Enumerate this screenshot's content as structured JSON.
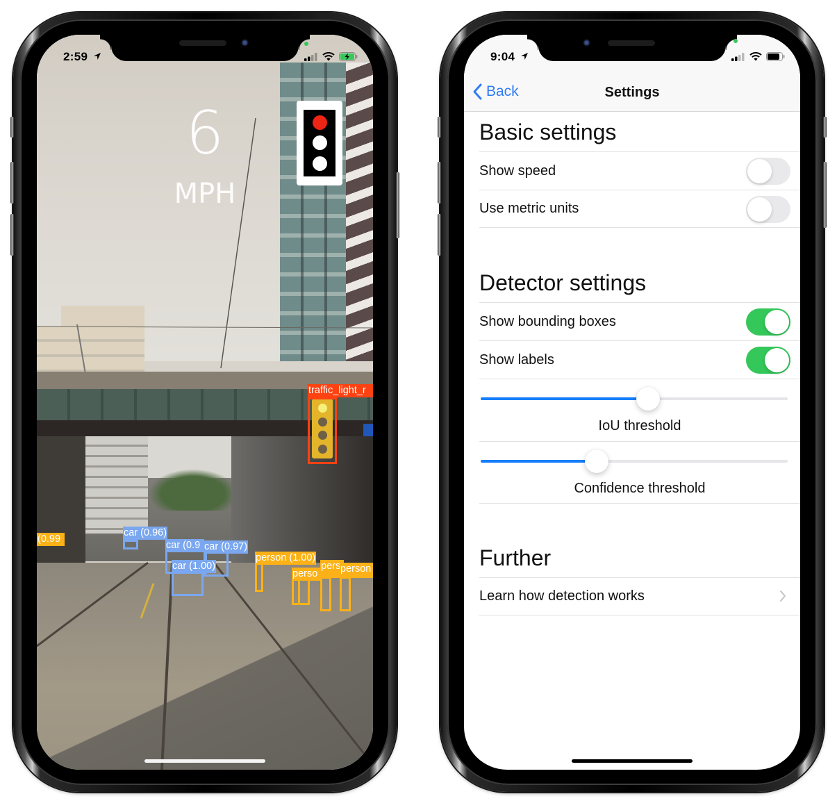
{
  "left_phone": {
    "status_bar": {
      "time": "2:59",
      "location_icon": "location-arrow-icon",
      "signal_icon": "cellular-signal-icon",
      "wifi_icon": "wifi-icon",
      "battery_icon": "battery-charging-icon",
      "battery_color": "#35c759"
    },
    "speed": {
      "value": "6",
      "unit": "MPH"
    },
    "traffic_light_indicator": {
      "state": "red",
      "red_color": "#ee2414"
    },
    "detections": [
      {
        "class": "traffic_light",
        "label": "traffic_light_r",
        "color": "#fe4211"
      },
      {
        "class": "car",
        "label": "car (0.96)",
        "color": "#7aa7ef"
      },
      {
        "class": "car",
        "label": "car (0.9",
        "color": "#7aa7ef"
      },
      {
        "class": "car",
        "label": "car (0.97)",
        "color": "#7aa7ef"
      },
      {
        "class": "car",
        "label": "car (1.00)",
        "color": "#7aa7ef"
      },
      {
        "class": "person",
        "label": "(0.99",
        "color": "#fbb117"
      },
      {
        "class": "person",
        "label": "person (1.00)",
        "color": "#fbb117"
      },
      {
        "class": "person",
        "label": "perso",
        "color": "#fbb117"
      },
      {
        "class": "person",
        "label": "pers",
        "color": "#fbb117"
      },
      {
        "class": "person",
        "label": "person",
        "color": "#fbb117"
      }
    ]
  },
  "right_phone": {
    "status_bar": {
      "time": "9:04",
      "location_icon": "location-arrow-icon",
      "signal_icon": "cellular-signal-icon",
      "wifi_icon": "wifi-icon",
      "battery_icon": "battery-icon"
    },
    "nav": {
      "back_label": "Back",
      "title": "Settings",
      "accent": "#2f7cf6"
    },
    "sections": {
      "basic": {
        "title": "Basic settings",
        "rows": [
          {
            "label": "Show speed",
            "on": false
          },
          {
            "label": "Use metric units",
            "on": false
          }
        ]
      },
      "detector": {
        "title": "Detector settings",
        "rows": [
          {
            "label": "Show bounding boxes",
            "on": true
          },
          {
            "label": "Show labels",
            "on": true
          }
        ],
        "sliders": [
          {
            "label": "IoU threshold",
            "fraction": 0.545
          },
          {
            "label": "Confidence threshold",
            "fraction": 0.377
          }
        ]
      },
      "further": {
        "title": "Further",
        "rows": [
          {
            "label": "Learn how detection works",
            "icon": "chevron-right-icon"
          }
        ]
      }
    },
    "colors": {
      "switch_on": "#34c759",
      "slider_fill": "#157efb"
    }
  }
}
